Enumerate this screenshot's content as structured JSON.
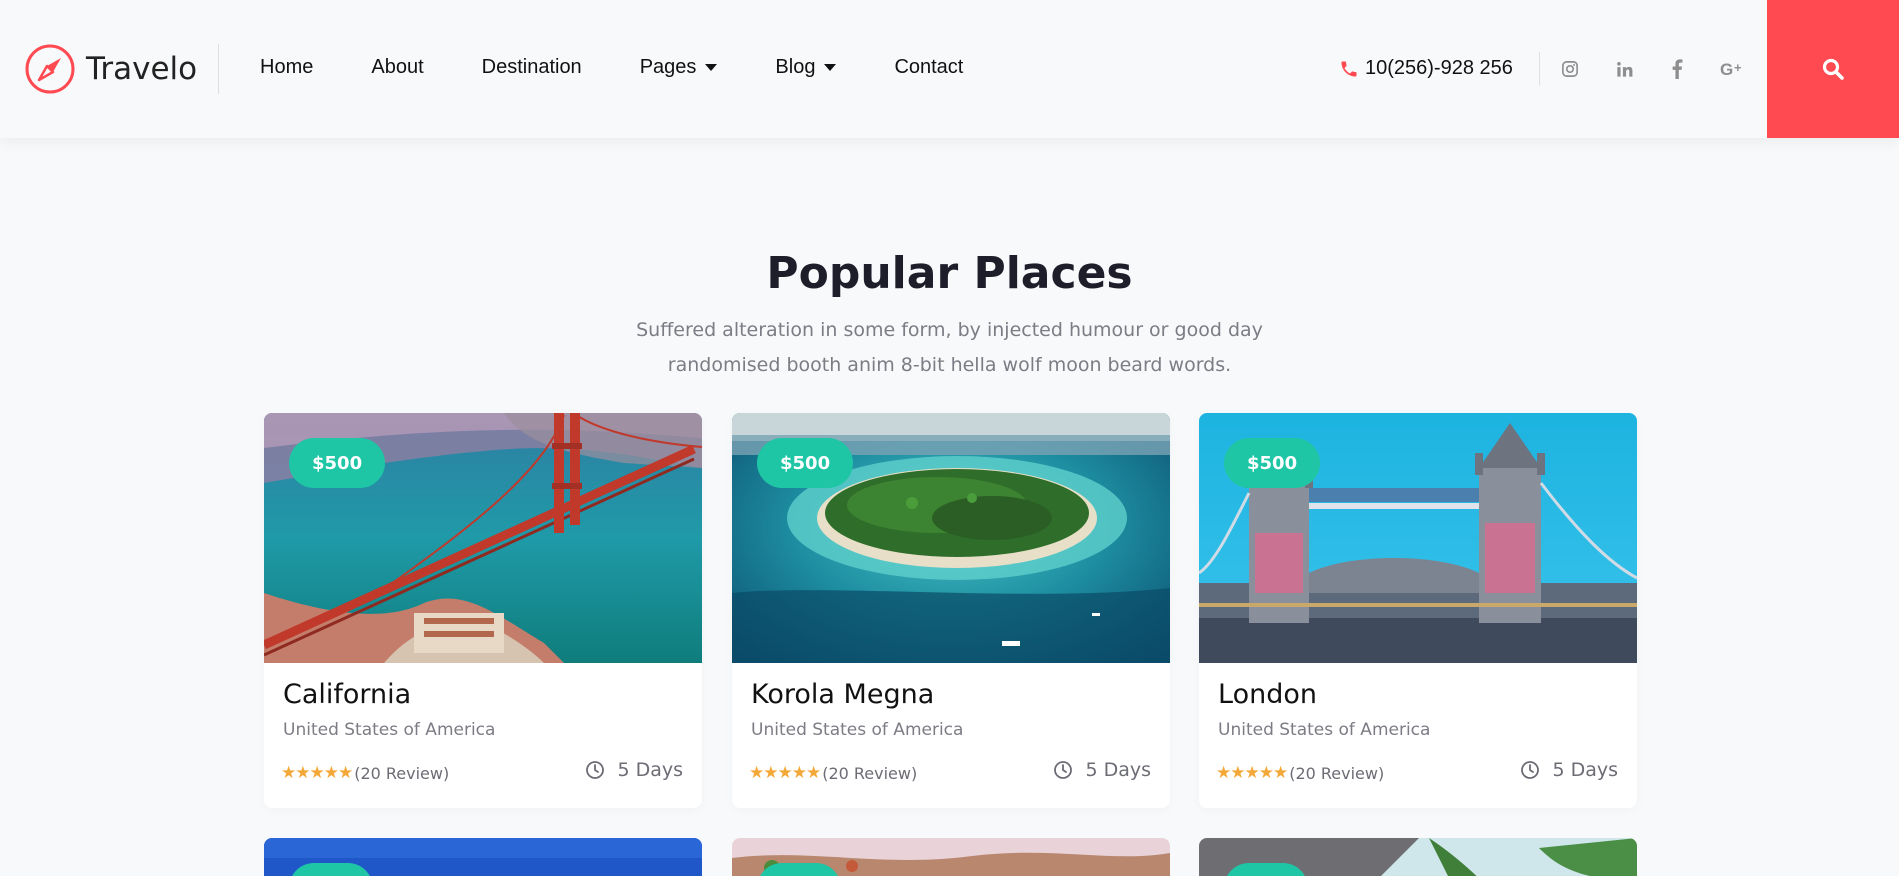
{
  "header": {
    "logo_text": "Travelo",
    "nav": [
      {
        "label": "Home"
      },
      {
        "label": "About"
      },
      {
        "label": "Destination"
      },
      {
        "label": "Pages",
        "dropdown": true
      },
      {
        "label": "Blog",
        "dropdown": true
      },
      {
        "label": "Contact"
      }
    ],
    "phone": "10(256)-928 256",
    "social_icons": [
      "instagram-icon",
      "linkedin-icon",
      "facebook-icon",
      "google-plus-icon"
    ],
    "accent_color": "#ff4a52"
  },
  "section": {
    "title": "Popular Places",
    "subtitle_line1": "Suffered alteration in some form, by injected humour or good day",
    "subtitle_line2": "randomised booth anim 8-bit hella wolf moon beard words."
  },
  "cards": [
    {
      "price": "$500",
      "title": "California",
      "country": "United States of America",
      "rating": 5,
      "reviews": "(20 Review)",
      "duration": "5 Days"
    },
    {
      "price": "$500",
      "title": "Korola Megna",
      "country": "United States of America",
      "rating": 5,
      "reviews": "(20 Review)",
      "duration": "5 Days"
    },
    {
      "price": "$500",
      "title": "London",
      "country": "United States of America",
      "rating": 5,
      "reviews": "(20 Review)",
      "duration": "5 Days"
    }
  ],
  "colors": {
    "price_badge": "#1ec6a6",
    "star": "#f3a93a"
  }
}
